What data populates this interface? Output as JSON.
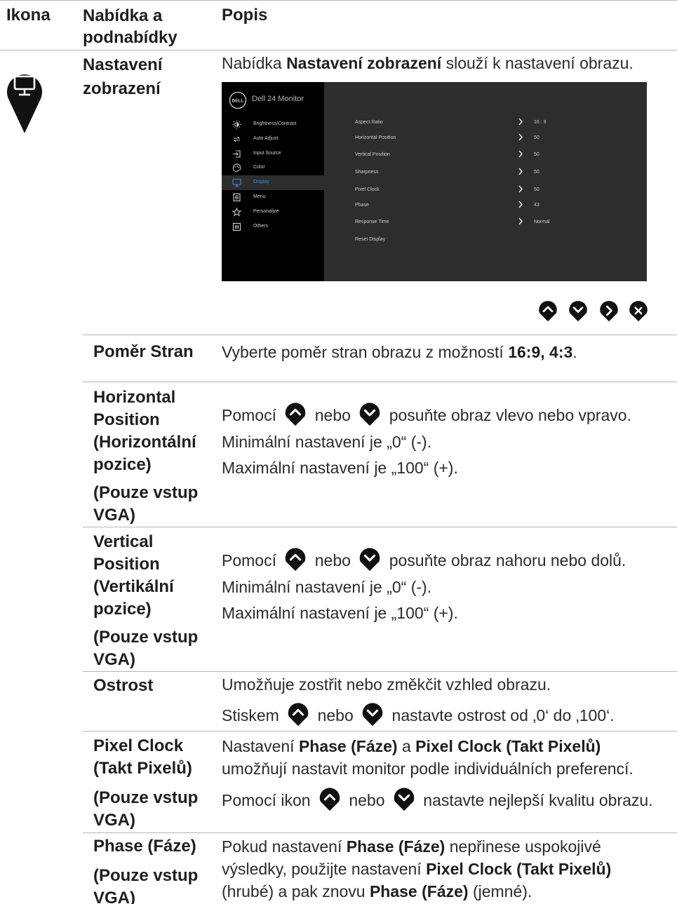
{
  "header": {
    "col_icon": "Ikona",
    "col_menu_line1": "Nabídka a",
    "col_menu_line2": "podnabídky",
    "col_desc": "Popis"
  },
  "section": {
    "icon": "monitor-icon",
    "title_line1": "Nastavení",
    "title_line2": "zobrazení",
    "desc_pre": "Nabídka ",
    "desc_bold": "Nastavení zobrazení",
    "desc_post": " slouží k nastavení obrazu."
  },
  "osd": {
    "title": "Dell 24 Monitor",
    "logo_text": "DELL",
    "menu": [
      {
        "label": "Brightness/Contrast",
        "icon": "brightness-icon"
      },
      {
        "label": "Auto Adjust",
        "icon": "auto-adjust-icon"
      },
      {
        "label": "Input Source",
        "icon": "input-source-icon"
      },
      {
        "label": "Color",
        "icon": "color-palette-icon"
      },
      {
        "label": "Display",
        "icon": "display-icon",
        "selected": true
      },
      {
        "label": "Menu",
        "icon": "menu-icon"
      },
      {
        "label": "Personalize",
        "icon": "star-icon"
      },
      {
        "label": "Others",
        "icon": "others-icon"
      }
    ],
    "settings": [
      {
        "label": "Aspect Ratio",
        "value": "16 : 9"
      },
      {
        "label": "Horizontal Position",
        "value": "50"
      },
      {
        "label": "Vertical Position",
        "value": "50"
      },
      {
        "label": "Sharpness",
        "value": "50"
      },
      {
        "label": "Pixel Clock",
        "value": "50"
      },
      {
        "label": "Phase",
        "value": "43"
      },
      {
        "label": "Response Time",
        "value": "Normal"
      },
      {
        "label": "Reset Display",
        "value": ""
      }
    ],
    "nav_buttons": [
      "up-button-icon",
      "down-button-icon",
      "right-button-icon",
      "close-button-icon"
    ]
  },
  "rows": {
    "aspect": {
      "label": "Poměr Stran",
      "desc_pre": "Vyberte poměr stran obrazu z možností ",
      "desc_bold": "16:9, 4:3",
      "desc_post": "."
    },
    "hpos": {
      "label_lines": [
        "Horizontal",
        "Position",
        "(Horizontální",
        "pozice)"
      ],
      "note_lines": [
        "(Pouze vstup",
        "VGA)"
      ],
      "line1_pre": "Pomocí ",
      "line1_mid": " nebo ",
      "line1_post": " posuňte obraz vlevo nebo vpravo.",
      "line2": "Minimální nastavení je „0“ (-).",
      "line3": "Maximální nastavení je „100“ (+)."
    },
    "vpos": {
      "label_lines": [
        "Vertical",
        "Position",
        "(Vertikální",
        "pozice)"
      ],
      "note_lines": [
        "(Pouze vstup",
        "VGA)"
      ],
      "line1_pre": "Pomocí ",
      "line1_mid": " nebo ",
      "line1_post": " posuňte obraz nahoru nebo dolů.",
      "line2": "Minimální nastavení je „0“ (-).",
      "line3": "Maximální nastavení je „100“ (+)."
    },
    "sharp": {
      "label": "Ostrost",
      "line1": "Umožňuje zostřit nebo změkčit vzhled obrazu.",
      "line2_pre": "Stiskem ",
      "line2_mid": " nebo ",
      "line2_post": " nastavte ostrost od ‚0‘ do ‚100‘."
    },
    "pixclock": {
      "label_lines": [
        "Pixel Clock",
        "(Takt Pixelů)"
      ],
      "note_lines": [
        "(Pouze vstup",
        "VGA)"
      ],
      "l1_pre": "Nastavení ",
      "l1_b1": "Phase (Fáze)",
      "l1_mid": " a ",
      "l1_b2": "Pixel Clock (Takt Pixelů)",
      "line2": "umožňují nastavit monitor podle individuálních preferencí.",
      "l3_pre": "Pomocí ikon ",
      "l3_mid": " nebo ",
      "l3_post": " nastavte nejlepší kvalitu obrazu."
    },
    "phase": {
      "label": "Phase (Fáze)",
      "note_lines": [
        "(Pouze vstup",
        "VGA)"
      ],
      "l1_pre": "Pokud nastavení ",
      "l1_b": "Phase (Fáze)",
      "l1_post": " nepřinese uspokojivé",
      "l2_pre": "výsledky, použijte nastavení ",
      "l2_b": "Pixel Clock (Takt Pixelů)",
      "l3_pre": "(hrubé) a pak znovu ",
      "l3_b": "Phase (Fáze)",
      "l3_post": " (jemné)."
    }
  }
}
